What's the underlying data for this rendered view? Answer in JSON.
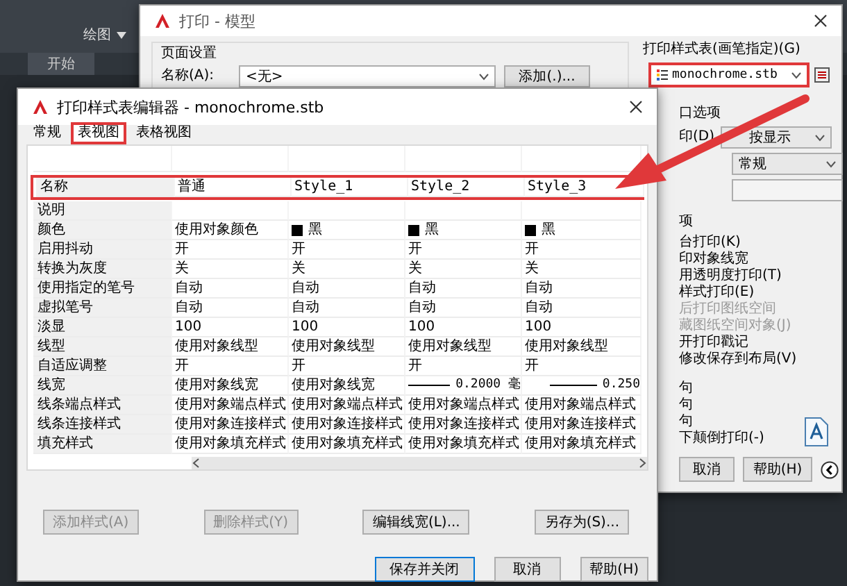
{
  "workspace": {
    "ribbon_label": "绘图",
    "tab": "开始"
  },
  "print_dialog": {
    "title": "打印 - 模型",
    "page_setup": {
      "title": "页面设置",
      "name_label": "名称(A):",
      "name_value": "<无>",
      "add_button": "添加(.)..."
    },
    "style_table": {
      "title": "打印样式表(画笔指定)(G)",
      "value": "monochrome.stb",
      "highlighted": true
    },
    "viewport": {
      "title": "口选项",
      "shade_label": "印(D)",
      "shade_value": "按显示",
      "quality_value": "常规"
    },
    "options": {
      "title": "项",
      "items": [
        {
          "label": "台打印(K)",
          "disabled": false
        },
        {
          "label": "印对象线宽",
          "disabled": false
        },
        {
          "label": "用透明度打印(T)",
          "disabled": false
        },
        {
          "label": "样式打印(E)",
          "disabled": false
        },
        {
          "label": "后打印图纸空间",
          "disabled": true
        },
        {
          "label": "藏图纸空间对象(J)",
          "disabled": true
        },
        {
          "label": "开打印戳记",
          "disabled": false
        },
        {
          "label": "修改保存到布局(V)",
          "disabled": false
        }
      ]
    },
    "orientation": {
      "items": [
        "句",
        "句",
        "句",
        "下颠倒打印(-)"
      ]
    },
    "buttons": [
      "取消",
      "帮助(H)"
    ]
  },
  "editor": {
    "title": "打印样式表编辑器 - monochrome.stb",
    "tabs": [
      {
        "label": "常规",
        "selected": false,
        "highlighted": false
      },
      {
        "label": "表视图",
        "selected": true,
        "highlighted": true
      },
      {
        "label": "表格视图",
        "selected": false,
        "highlighted": false
      }
    ],
    "header": {
      "highlighted": true,
      "cells": [
        "名称",
        "普通",
        "Style_1",
        "Style_2",
        "Style_3"
      ]
    },
    "rows": [
      {
        "label": "说明",
        "cells": []
      },
      {
        "label": "颜色",
        "cells": [
          {
            "kind": "text",
            "text": "使用对象颜色"
          },
          {
            "kind": "swatch",
            "text": "黑"
          },
          {
            "kind": "swatch",
            "text": "黑"
          },
          {
            "kind": "swatch",
            "text": "黑"
          }
        ]
      },
      {
        "label": "启用抖动",
        "cells": [
          {
            "kind": "text",
            "text": "开"
          },
          {
            "kind": "text",
            "text": "开"
          },
          {
            "kind": "text",
            "text": "开"
          },
          {
            "kind": "text",
            "text": "开"
          }
        ]
      },
      {
        "label": "转换为灰度",
        "cells": [
          {
            "kind": "text",
            "text": "关"
          },
          {
            "kind": "text",
            "text": "关"
          },
          {
            "kind": "text",
            "text": "关"
          },
          {
            "kind": "text",
            "text": "关"
          }
        ]
      },
      {
        "label": "使用指定的笔号",
        "cells": [
          {
            "kind": "text",
            "text": "自动"
          },
          {
            "kind": "text",
            "text": "自动"
          },
          {
            "kind": "text",
            "text": "自动"
          },
          {
            "kind": "text",
            "text": "自动"
          }
        ]
      },
      {
        "label": "虚拟笔号",
        "cells": [
          {
            "kind": "text",
            "text": "自动"
          },
          {
            "kind": "text",
            "text": "自动"
          },
          {
            "kind": "text",
            "text": "自动"
          },
          {
            "kind": "text",
            "text": "自动"
          }
        ]
      },
      {
        "label": "淡显",
        "cells": [
          {
            "kind": "text",
            "text": "100"
          },
          {
            "kind": "text",
            "text": "100"
          },
          {
            "kind": "text",
            "text": "100"
          },
          {
            "kind": "text",
            "text": "100"
          }
        ]
      },
      {
        "label": "线型",
        "cells": [
          {
            "kind": "text",
            "text": "使用对象线型"
          },
          {
            "kind": "text",
            "text": "使用对象线型"
          },
          {
            "kind": "text",
            "text": "使用对象线型"
          },
          {
            "kind": "text",
            "text": "使用对象线型"
          }
        ]
      },
      {
        "label": "自适应调整",
        "cells": [
          {
            "kind": "text",
            "text": "开"
          },
          {
            "kind": "text",
            "text": "开"
          },
          {
            "kind": "text",
            "text": "开"
          },
          {
            "kind": "text",
            "text": "开"
          }
        ]
      },
      {
        "label": "线宽",
        "cells": [
          {
            "kind": "text",
            "text": "使用对象线宽"
          },
          {
            "kind": "text",
            "text": "使用对象线宽"
          },
          {
            "kind": "line",
            "text": "0.2000 毫"
          },
          {
            "kind": "line",
            "text": "0.250"
          }
        ]
      },
      {
        "label": "线条端点样式",
        "cells": [
          {
            "kind": "text",
            "text": "使用对象端点样式"
          },
          {
            "kind": "text",
            "text": "使用对象端点样式"
          },
          {
            "kind": "text",
            "text": "使用对象端点样式"
          },
          {
            "kind": "text",
            "text": "使用对象端点样式"
          }
        ]
      },
      {
        "label": "线条连接样式",
        "cells": [
          {
            "kind": "text",
            "text": "使用对象连接样式"
          },
          {
            "kind": "text",
            "text": "使用对象连接样式"
          },
          {
            "kind": "text",
            "text": "使用对象连接样式"
          },
          {
            "kind": "text",
            "text": "使用对象连接样式"
          }
        ]
      },
      {
        "label": "填充样式",
        "cells": [
          {
            "kind": "text",
            "text": "使用对象填充样式"
          },
          {
            "kind": "text",
            "text": "使用对象填充样式"
          },
          {
            "kind": "text",
            "text": "使用对象填充样式"
          },
          {
            "kind": "text",
            "text": "使用对象填充样式"
          }
        ]
      }
    ],
    "actions": [
      {
        "label": "添加样式(A)",
        "disabled": true
      },
      {
        "label": "删除样式(Y)",
        "disabled": true
      },
      {
        "label": "编辑线宽(L)...",
        "disabled": false
      },
      {
        "label": "另存为(S)...",
        "disabled": false
      }
    ],
    "footer": [
      {
        "label": "保存并关闭",
        "default": true
      },
      {
        "label": "取消",
        "default": false
      },
      {
        "label": "帮助(H)",
        "default": false
      }
    ]
  }
}
